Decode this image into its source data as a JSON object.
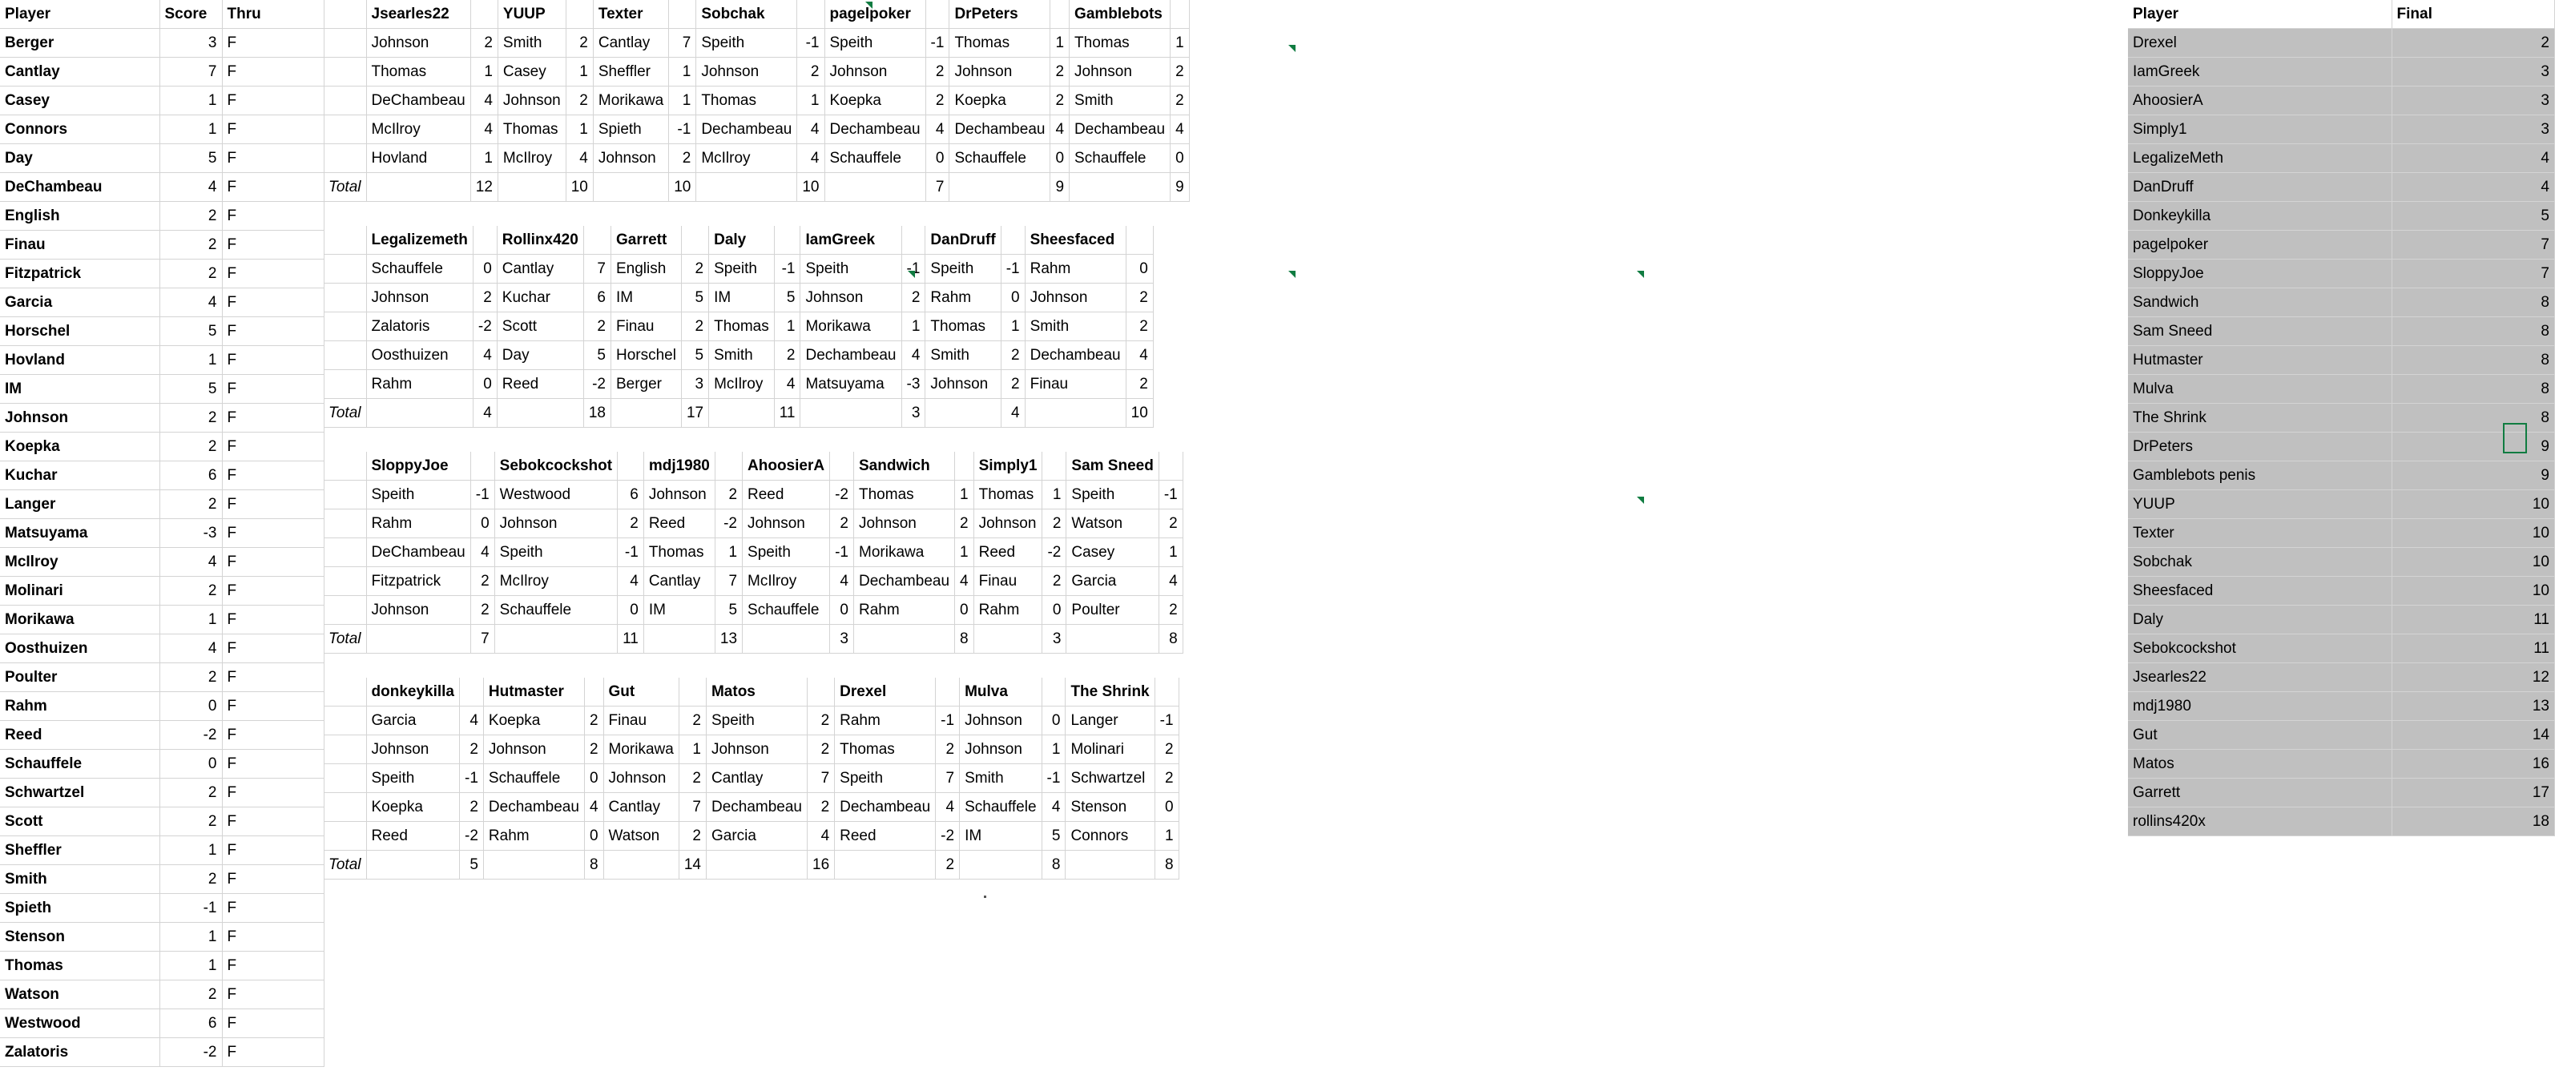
{
  "leaderboard": {
    "headers": [
      "Player",
      "Score",
      "Thru"
    ],
    "rows": [
      {
        "player": "Berger",
        "score": "3",
        "thru": "F"
      },
      {
        "player": "Cantlay",
        "score": "7",
        "thru": "F"
      },
      {
        "player": "Casey",
        "score": "1",
        "thru": "F"
      },
      {
        "player": "Connors",
        "score": "1",
        "thru": "F"
      },
      {
        "player": "Day",
        "score": "5",
        "thru": "F"
      },
      {
        "player": "DeChambeau",
        "score": "4",
        "thru": "F"
      },
      {
        "player": "English",
        "score": "2",
        "thru": "F"
      },
      {
        "player": "Finau",
        "score": "2",
        "thru": "F"
      },
      {
        "player": "Fitzpatrick",
        "score": "2",
        "thru": "F"
      },
      {
        "player": "Garcia",
        "score": "4",
        "thru": "F"
      },
      {
        "player": "Horschel",
        "score": "5",
        "thru": "F"
      },
      {
        "player": "Hovland",
        "score": "1",
        "thru": "F"
      },
      {
        "player": "IM",
        "score": "5",
        "thru": "F"
      },
      {
        "player": "Johnson",
        "score": "2",
        "thru": "F"
      },
      {
        "player": "Koepka",
        "score": "2",
        "thru": "F"
      },
      {
        "player": "Kuchar",
        "score": "6",
        "thru": "F"
      },
      {
        "player": "Langer",
        "score": "2",
        "thru": "F"
      },
      {
        "player": "Matsuyama",
        "score": "-3",
        "thru": "F"
      },
      {
        "player": "McIlroy",
        "score": "4",
        "thru": "F"
      },
      {
        "player": "Molinari",
        "score": "2",
        "thru": "F"
      },
      {
        "player": "Morikawa",
        "score": "1",
        "thru": "F"
      },
      {
        "player": "Oosthuizen",
        "score": "4",
        "thru": "F"
      },
      {
        "player": "Poulter",
        "score": "2",
        "thru": "F"
      },
      {
        "player": "Rahm",
        "score": "0",
        "thru": "F"
      },
      {
        "player": "Reed",
        "score": "-2",
        "thru": "F"
      },
      {
        "player": "Schauffele",
        "score": "0",
        "thru": "F"
      },
      {
        "player": "Schwartzel",
        "score": "2",
        "thru": "F"
      },
      {
        "player": "Scott",
        "score": "2",
        "thru": "F"
      },
      {
        "player": "Sheffler",
        "score": "1",
        "thru": "F"
      },
      {
        "player": "Smith",
        "score": "2",
        "thru": "F"
      },
      {
        "player": "Spieth",
        "score": "-1",
        "thru": "F"
      },
      {
        "player": "Stenson",
        "score": "1",
        "thru": "F"
      },
      {
        "player": "Thomas",
        "score": "1",
        "thru": "F"
      },
      {
        "player": "Watson",
        "score": "2",
        "thru": "F"
      },
      {
        "player": "Westwood",
        "score": "6",
        "thru": "F"
      },
      {
        "player": "Zalatoris",
        "score": "-2",
        "thru": "F"
      }
    ]
  },
  "teams": {
    "total_label": "Total",
    "blocks": [
      [
        {
          "name": "Jsearles22",
          "picks": [
            {
              "p": "Johnson",
              "v": "2"
            },
            {
              "p": "Thomas",
              "v": "1"
            },
            {
              "p": "DeChambeau",
              "v": "4"
            },
            {
              "p": "McIlroy",
              "v": "4"
            },
            {
              "p": "Hovland",
              "v": "1"
            }
          ],
          "total": "12"
        },
        {
          "name": "YUUP",
          "picks": [
            {
              "p": "Smith",
              "v": "2"
            },
            {
              "p": "Casey",
              "v": "1"
            },
            {
              "p": "Johnson",
              "v": "2"
            },
            {
              "p": "Thomas",
              "v": "1"
            },
            {
              "p": "McIlroy",
              "v": "4"
            }
          ],
          "total": "10"
        },
        {
          "name": "Texter",
          "picks": [
            {
              "p": "Cantlay",
              "v": "7"
            },
            {
              "p": "Sheffler",
              "v": "1"
            },
            {
              "p": "Morikawa",
              "v": "1"
            },
            {
              "p": "Spieth",
              "v": "-1"
            },
            {
              "p": "Johnson",
              "v": "2"
            }
          ],
          "total": "10"
        },
        {
          "name": "Sobchak",
          "picks": [
            {
              "p": "Speith",
              "v": "-1"
            },
            {
              "p": "Johnson",
              "v": "2"
            },
            {
              "p": "Thomas",
              "v": "1"
            },
            {
              "p": "Dechambeau",
              "v": "4"
            },
            {
              "p": "McIlroy",
              "v": "4"
            }
          ],
          "total": "10"
        },
        {
          "name": "pagelpoker",
          "picks": [
            {
              "p": "Speith",
              "v": "-1"
            },
            {
              "p": "Johnson",
              "v": "2"
            },
            {
              "p": "Koepka",
              "v": "2"
            },
            {
              "p": "Dechambeau",
              "v": "4"
            },
            {
              "p": "Schauffele",
              "v": "0"
            }
          ],
          "total": "7"
        },
        {
          "name": "DrPeters",
          "picks": [
            {
              "p": "Thomas",
              "v": "1"
            },
            {
              "p": "Johnson",
              "v": "2"
            },
            {
              "p": "Koepka",
              "v": "2"
            },
            {
              "p": "Dechambeau",
              "v": "4"
            },
            {
              "p": "Schauffele",
              "v": "0"
            }
          ],
          "total": "9"
        },
        {
          "name": "Gamblebots",
          "picks": [
            {
              "p": "Thomas",
              "v": "1"
            },
            {
              "p": "Johnson",
              "v": "2"
            },
            {
              "p": "Smith",
              "v": "2"
            },
            {
              "p": "Dechambeau",
              "v": "4"
            },
            {
              "p": "Schauffele",
              "v": "0"
            }
          ],
          "total": "9"
        }
      ],
      [
        {
          "name": "Legalizemeth",
          "picks": [
            {
              "p": "Schauffele",
              "v": "0"
            },
            {
              "p": "Johnson",
              "v": "2"
            },
            {
              "p": "Zalatoris",
              "v": "-2"
            },
            {
              "p": "Oosthuizen",
              "v": "4"
            },
            {
              "p": "Rahm",
              "v": "0"
            }
          ],
          "total": "4"
        },
        {
          "name": "Rollinx420",
          "picks": [
            {
              "p": "Cantlay",
              "v": "7"
            },
            {
              "p": "Kuchar",
              "v": "6"
            },
            {
              "p": "Scott",
              "v": "2"
            },
            {
              "p": "Day",
              "v": "5"
            },
            {
              "p": "Reed",
              "v": "-2"
            }
          ],
          "total": "18"
        },
        {
          "name": "Garrett",
          "picks": [
            {
              "p": "English",
              "v": "2"
            },
            {
              "p": "IM",
              "v": "5"
            },
            {
              "p": "Finau",
              "v": "2"
            },
            {
              "p": "Horschel",
              "v": "5"
            },
            {
              "p": "Berger",
              "v": "3"
            }
          ],
          "total": "17"
        },
        {
          "name": "Daly",
          "picks": [
            {
              "p": "Speith",
              "v": "-1"
            },
            {
              "p": "IM",
              "v": "5"
            },
            {
              "p": "Thomas",
              "v": "1"
            },
            {
              "p": "Smith",
              "v": "2"
            },
            {
              "p": "McIlroy",
              "v": "4"
            }
          ],
          "total": "11"
        },
        {
          "name": "IamGreek",
          "picks": [
            {
              "p": "Speith",
              "v": "-1"
            },
            {
              "p": "Johnson",
              "v": "2"
            },
            {
              "p": "Morikawa",
              "v": "1"
            },
            {
              "p": "Dechambeau",
              "v": "4"
            },
            {
              "p": "Matsuyama",
              "v": "-3"
            }
          ],
          "total": "3"
        },
        {
          "name": "DanDruff",
          "picks": [
            {
              "p": "Speith",
              "v": "-1"
            },
            {
              "p": "Rahm",
              "v": "0"
            },
            {
              "p": "Thomas",
              "v": "1"
            },
            {
              "p": "Smith",
              "v": "2"
            },
            {
              "p": "Johnson",
              "v": "2"
            }
          ],
          "total": "4"
        },
        {
          "name": "Sheesfaced",
          "picks": [
            {
              "p": "Rahm",
              "v": "0"
            },
            {
              "p": "Johnson",
              "v": "2"
            },
            {
              "p": "Smith",
              "v": "2"
            },
            {
              "p": "Dechambeau",
              "v": "4"
            },
            {
              "p": "Finau",
              "v": "2"
            }
          ],
          "total": "10"
        }
      ],
      [
        {
          "name": "SloppyJoe",
          "picks": [
            {
              "p": "Speith",
              "v": "-1"
            },
            {
              "p": "Rahm",
              "v": "0"
            },
            {
              "p": "DeChambeau",
              "v": "4"
            },
            {
              "p": "Fitzpatrick",
              "v": "2"
            },
            {
              "p": "Johnson",
              "v": "2"
            }
          ],
          "total": "7"
        },
        {
          "name": "Sebokcockshot",
          "picks": [
            {
              "p": "Westwood",
              "v": "6"
            },
            {
              "p": "Johnson",
              "v": "2"
            },
            {
              "p": "Speith",
              "v": "-1"
            },
            {
              "p": "McIlroy",
              "v": "4"
            },
            {
              "p": "Schauffele",
              "v": "0"
            }
          ],
          "total": "11"
        },
        {
          "name": "mdj1980",
          "picks": [
            {
              "p": "Johnson",
              "v": "2"
            },
            {
              "p": "Reed",
              "v": "-2"
            },
            {
              "p": "Thomas",
              "v": "1"
            },
            {
              "p": "Cantlay",
              "v": "7"
            },
            {
              "p": "IM",
              "v": "5"
            }
          ],
          "total": "13"
        },
        {
          "name": "AhoosierA",
          "picks": [
            {
              "p": "Reed",
              "v": "-2"
            },
            {
              "p": "Johnson",
              "v": "2"
            },
            {
              "p": "Speith",
              "v": "-1"
            },
            {
              "p": "McIlroy",
              "v": "4"
            },
            {
              "p": "Schauffele",
              "v": "0"
            }
          ],
          "total": "3"
        },
        {
          "name": "Sandwich",
          "picks": [
            {
              "p": "Thomas",
              "v": "1"
            },
            {
              "p": "Johnson",
              "v": "2"
            },
            {
              "p": "Morikawa",
              "v": "1"
            },
            {
              "p": "Dechambeau",
              "v": "4"
            },
            {
              "p": "Rahm",
              "v": "0"
            }
          ],
          "total": "8"
        },
        {
          "name": "Simply1",
          "picks": [
            {
              "p": "Thomas",
              "v": "1"
            },
            {
              "p": "Johnson",
              "v": "2"
            },
            {
              "p": "Reed",
              "v": "-2"
            },
            {
              "p": "Finau",
              "v": "2"
            },
            {
              "p": "Rahm",
              "v": "0"
            }
          ],
          "total": "3"
        },
        {
          "name": "Sam Sneed",
          "picks": [
            {
              "p": "Speith",
              "v": "-1"
            },
            {
              "p": "Watson",
              "v": "2"
            },
            {
              "p": "Casey",
              "v": "1"
            },
            {
              "p": "Garcia",
              "v": "4"
            },
            {
              "p": "Poulter",
              "v": "2"
            }
          ],
          "total": "8"
        }
      ],
      [
        {
          "name": "donkeykilla",
          "picks": [
            {
              "p": "Garcia",
              "v": "4"
            },
            {
              "p": "Johnson",
              "v": "2"
            },
            {
              "p": "Speith",
              "v": "-1"
            },
            {
              "p": "Koepka",
              "v": "2"
            },
            {
              "p": "Reed",
              "v": "-2"
            }
          ],
          "total": "5"
        },
        {
          "name": "Hutmaster",
          "picks": [
            {
              "p": "Koepka",
              "v": "2"
            },
            {
              "p": "Johnson",
              "v": "2"
            },
            {
              "p": "Schauffele",
              "v": "0"
            },
            {
              "p": "Dechambeau",
              "v": "4"
            },
            {
              "p": "Rahm",
              "v": "0"
            }
          ],
          "total": "8"
        },
        {
          "name": "Gut",
          "picks": [
            {
              "p": "Finau",
              "v": "2"
            },
            {
              "p": "Morikawa",
              "v": "1"
            },
            {
              "p": "Johnson",
              "v": "2"
            },
            {
              "p": "Cantlay",
              "v": "7"
            },
            {
              "p": "Watson",
              "v": "2"
            }
          ],
          "total": "14"
        },
        {
          "name": "Matos",
          "picks": [
            {
              "p": "Speith",
              "v": "2"
            },
            {
              "p": "Johnson",
              "v": "2"
            },
            {
              "p": "Cantlay",
              "v": "7"
            },
            {
              "p": "Dechambeau",
              "v": "2"
            },
            {
              "p": "Garcia",
              "v": "4"
            }
          ],
          "total": "16"
        },
        {
          "name": "Drexel",
          "picks": [
            {
              "p": "Rahm",
              "v": "-1"
            },
            {
              "p": "Thomas",
              "v": "2"
            },
            {
              "p": "Speith",
              "v": "7"
            },
            {
              "p": "Dechambeau",
              "v": "4"
            },
            {
              "p": "Reed",
              "v": "-2"
            }
          ],
          "total": "2"
        },
        {
          "name": "Mulva",
          "picks": [
            {
              "p": "Johnson",
              "v": "0"
            },
            {
              "p": "Johnson",
              "v": "1"
            },
            {
              "p": "Smith",
              "v": "-1"
            },
            {
              "p": "Schauffele",
              "v": "4"
            },
            {
              "p": "IM",
              "v": "5"
            }
          ],
          "total": "8"
        },
        {
          "name": "The Shrink",
          "picks": [
            {
              "p": "Langer",
              "v": "-1"
            },
            {
              "p": "Molinari",
              "v": "2"
            },
            {
              "p": "Schwartzel",
              "v": "2"
            },
            {
              "p": "Stenson",
              "v": "0"
            },
            {
              "p": "Connors",
              "v": "1"
            }
          ],
          "total": "8"
        }
      ]
    ]
  },
  "standings": {
    "headers": [
      "Player",
      "Final"
    ],
    "rows": [
      {
        "player": "Drexel",
        "final": "2"
      },
      {
        "player": "IamGreek",
        "final": "3"
      },
      {
        "player": "AhoosierA",
        "final": "3"
      },
      {
        "player": "Simply1",
        "final": "3"
      },
      {
        "player": "LegalizeMeth",
        "final": "4"
      },
      {
        "player": "DanDruff",
        "final": "4"
      },
      {
        "player": "Donkeykilla",
        "final": "5"
      },
      {
        "player": "pagelpoker",
        "final": "7"
      },
      {
        "player": "SloppyJoe",
        "final": "7"
      },
      {
        "player": "Sandwich",
        "final": "8"
      },
      {
        "player": "Sam Sneed",
        "final": "8"
      },
      {
        "player": "Hutmaster",
        "final": "8"
      },
      {
        "player": "Mulva",
        "final": "8"
      },
      {
        "player": "The Shrink",
        "final": "8"
      },
      {
        "player": "DrPeters",
        "final": "9"
      },
      {
        "player": "Gamblebots penis",
        "final": "9"
      },
      {
        "player": "YUUP",
        "final": "10"
      },
      {
        "player": "Texter",
        "final": "10"
      },
      {
        "player": "Sobchak",
        "final": "10"
      },
      {
        "player": "Sheesfaced",
        "final": "10"
      },
      {
        "player": "Daly",
        "final": "11"
      },
      {
        "player": "Sebokcockshot",
        "final": "11"
      },
      {
        "player": "Jsearles22",
        "final": "12"
      },
      {
        "player": "mdj1980",
        "final": "13"
      },
      {
        "player": "Gut",
        "final": "14"
      },
      {
        "player": "Matos",
        "final": "16"
      },
      {
        "player": "Garrett",
        "final": "17"
      },
      {
        "player": "rollins420x",
        "final": "18"
      }
    ]
  },
  "colors": {
    "grid": "#d4d4d4",
    "shade": "#c0c0c0",
    "selection": "#107c41"
  }
}
